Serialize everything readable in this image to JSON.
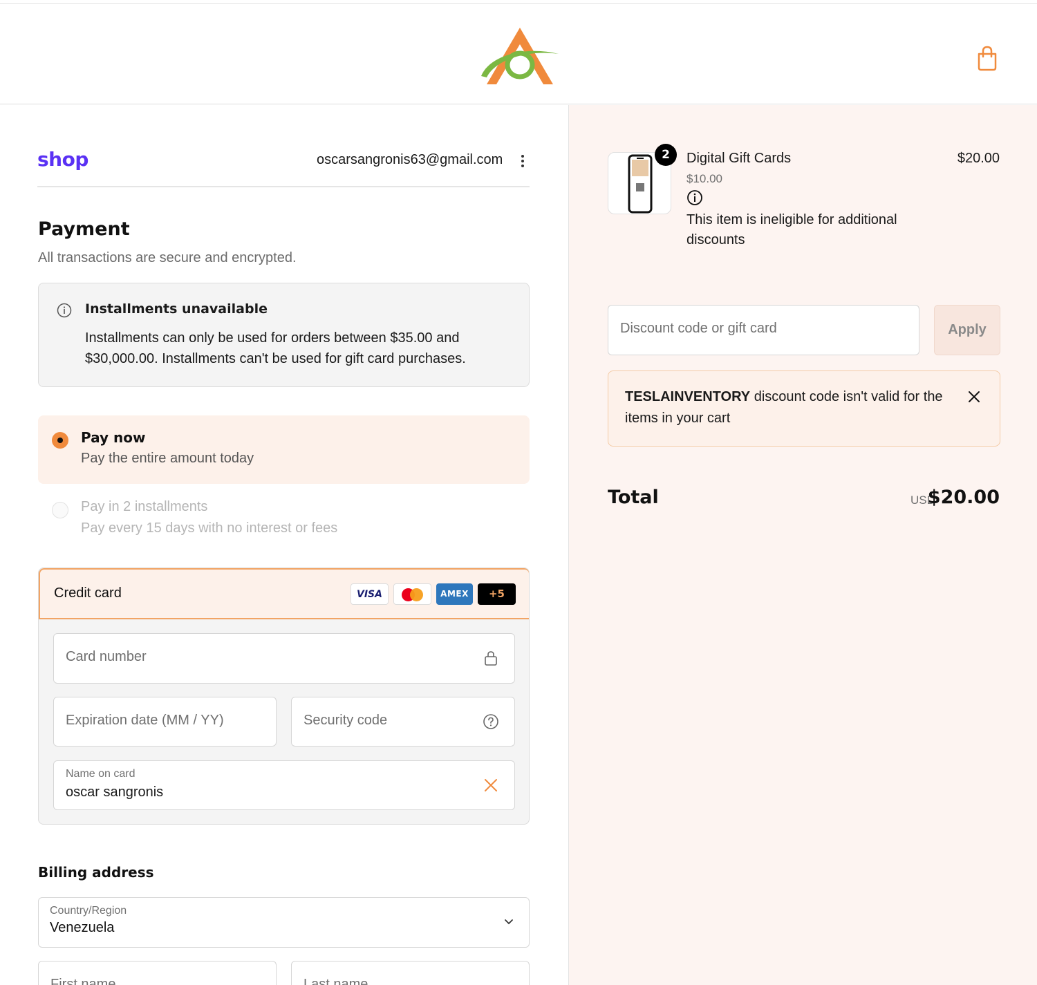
{
  "header": {
    "logo": "store-logo",
    "cart_icon": "shopping-bag-icon"
  },
  "account": {
    "brand": "shop",
    "email": "oscarsangronis63@gmail.com"
  },
  "payment": {
    "title": "Payment",
    "subtitle": "All transactions are secure and encrypted.",
    "notice": {
      "title": "Installments unavailable",
      "text": "Installments can only be used for orders between $35.00 and $30,000.00. Installments can't be used for gift card purchases."
    },
    "options": [
      {
        "title": "Pay now",
        "subtitle": "Pay the entire amount today",
        "selected": true
      },
      {
        "title": "Pay in 2 installments",
        "subtitle": "Pay every 15 days with no interest or fees",
        "selected": false
      }
    ],
    "credit_card": {
      "label": "Credit card",
      "brands": [
        "VISA",
        "AMEX",
        "+5"
      ],
      "card_number_placeholder": "Card number",
      "expiration_placeholder": "Expiration date (MM / YY)",
      "security_placeholder": "Security code",
      "name_label": "Name on card",
      "name_value": "oscar sangronis"
    }
  },
  "billing": {
    "title": "Billing address",
    "country_label": "Country/Region",
    "country_value": "Venezuela",
    "first_name_placeholder": "First name",
    "last_name_placeholder": "Last name"
  },
  "order": {
    "item": {
      "quantity": "2",
      "name": "Digital Gift Cards",
      "line_price": "$20.00",
      "unit_price": "$10.00",
      "note": "This item is ineligible for additional discounts"
    },
    "discount_placeholder": "Discount code or gift card",
    "apply_label": "Apply",
    "error": {
      "code": "TESLAINVENTORY",
      "message": " discount code isn't valid for the items in your cart"
    },
    "total_label": "Total",
    "currency": "USD",
    "total_value": "$20.00"
  },
  "colors": {
    "accent": "#f08a3c",
    "shop_brand": "#5a31f4",
    "panel_bg": "#fdf4f1"
  }
}
